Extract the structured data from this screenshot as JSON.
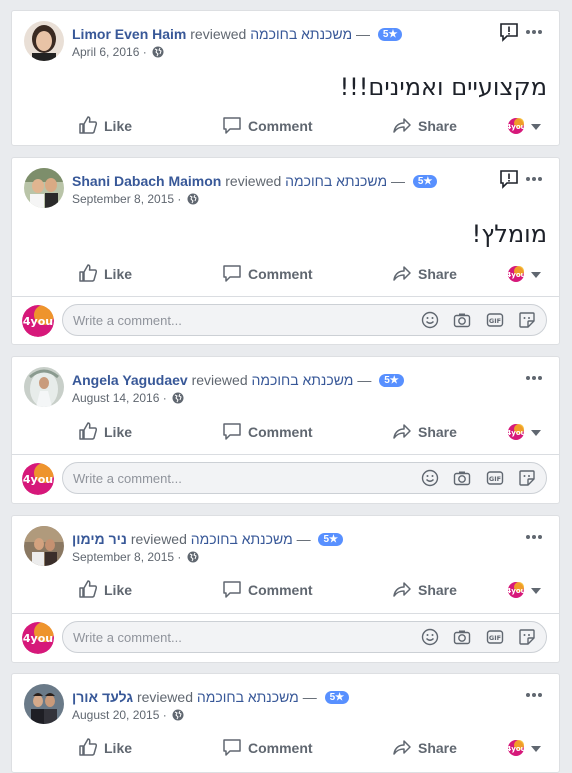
{
  "reviews": [
    {
      "user": "Limor Even Haim",
      "verb": "reviewed",
      "page": "משכנתא בחוכמה",
      "dash": "—",
      "rating": "5★",
      "date": "April 6, 2016",
      "text": "מקצועיים ואמינים!!!",
      "has_report": true,
      "has_comment": false
    },
    {
      "user": "Shani Dabach Maimon",
      "verb": "reviewed",
      "page": "משכנתא בחוכמה",
      "dash": "—",
      "rating": "5★",
      "date": "September 8, 2015",
      "text": "מומלץ!",
      "has_report": true,
      "has_comment": true
    },
    {
      "user": "Angela Yagudaev",
      "verb": "reviewed",
      "page": "משכנתא בחוכמה",
      "dash": "—",
      "rating": "5★",
      "date": "August 14, 2016",
      "text": "",
      "has_report": false,
      "has_comment": true
    },
    {
      "user": "ניר מימון",
      "verb": "reviewed",
      "page": "משכנתא בחוכמה",
      "dash": "—",
      "rating": "5★",
      "date": "September 8, 2015",
      "text": "",
      "has_report": false,
      "has_comment": true
    },
    {
      "user": "גלעד אורן",
      "verb": "reviewed",
      "page": "משכנתא בחוכמה",
      "dash": "—",
      "rating": "5★",
      "date": "August 20, 2015",
      "text": "",
      "has_report": false,
      "has_comment": false
    }
  ],
  "actions": {
    "like": "Like",
    "comment": "Comment",
    "share": "Share"
  },
  "comment_placeholder": "Write a comment...",
  "brand_logo_text": "4you",
  "colors": {
    "link": "#385898",
    "badge": "#5890ff",
    "brand": "#d6187a"
  }
}
